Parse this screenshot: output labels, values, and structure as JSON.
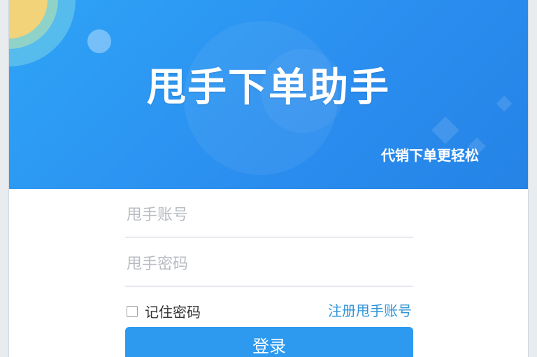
{
  "header": {
    "title": "甩手下单助手",
    "slogan": "代销下单更轻松"
  },
  "form": {
    "account_placeholder": "甩手账号",
    "password_placeholder": "甩手密码",
    "remember_label": "记住密码",
    "remember_checked": false,
    "register_link": "注册甩手账号",
    "login_button": "登录"
  },
  "colors": {
    "banner": "#2b8ff0",
    "button": "#2d9af0",
    "link": "#2f95d8"
  }
}
